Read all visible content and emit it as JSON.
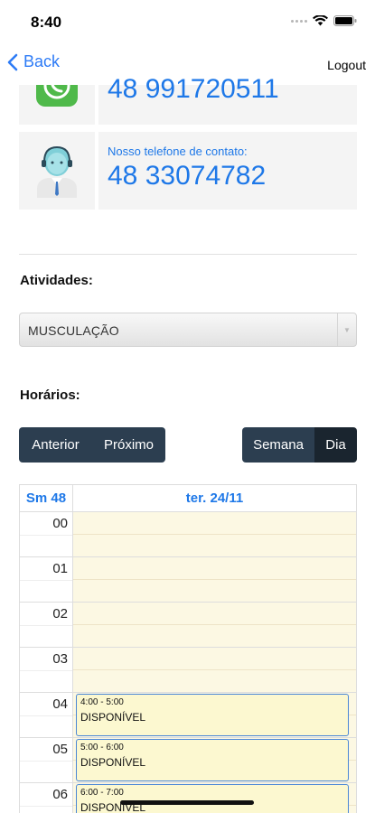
{
  "status_bar": {
    "time": "8:40"
  },
  "nav": {
    "back_label": "Back",
    "logout_label": "Logout"
  },
  "contacts": {
    "whatsapp": {
      "icon": "whatsapp-icon",
      "phone": "48 991720511"
    },
    "support": {
      "icon": "support-agent-icon",
      "label": "Nosso telefone de contato:",
      "phone": "48 33074782"
    }
  },
  "activities": {
    "label": "Atividades:",
    "selected": "MUSCULAÇÃO"
  },
  "schedule": {
    "label": "Horários:",
    "nav_buttons": {
      "prev": "Anterior",
      "next": "Próximo"
    },
    "view_buttons": {
      "week": "Semana",
      "day": "Dia",
      "active": "Dia"
    }
  },
  "calendar": {
    "week_label": "Sm 48",
    "day_label": "ter. 24/11",
    "hours": [
      "00",
      "01",
      "02",
      "03",
      "04",
      "05",
      "06"
    ],
    "events": [
      {
        "time": "4:00 - 5:00",
        "title": "DISPONÍVEL"
      },
      {
        "time": "5:00 - 6:00",
        "title": "DISPONÍVEL"
      },
      {
        "time": "6:00 - 7:00",
        "title": "DISPONÍVEL"
      }
    ]
  },
  "colors": {
    "accent": "#1e78e8",
    "dark_button": "#2c3e50",
    "slot_bg": "#fcf8e3"
  }
}
